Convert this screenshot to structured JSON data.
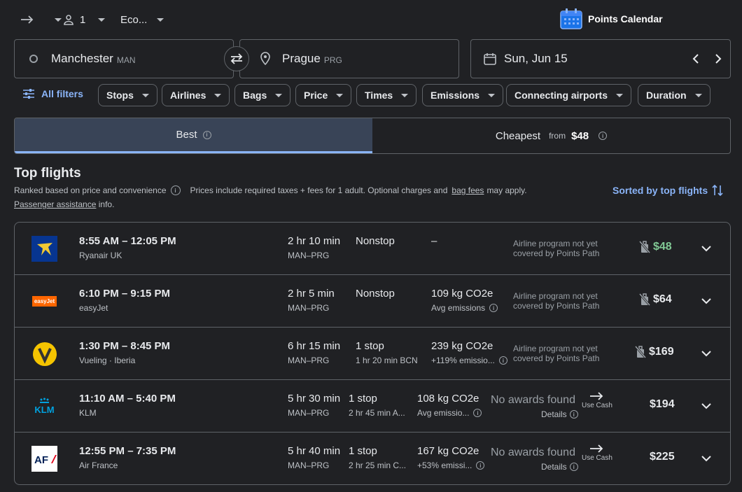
{
  "topbar": {
    "trip_type_icon": "arrow-right-icon",
    "passengers": "1",
    "cabin": "Eco...",
    "points_calendar": "Points Calendar"
  },
  "search": {
    "origin_city": "Manchester",
    "origin_code": "MAN",
    "dest_city": "Prague",
    "dest_code": "PRG",
    "date": "Sun, Jun 15"
  },
  "filters": {
    "all_filters": "All filters",
    "chips": [
      "Stops",
      "Airlines",
      "Bags",
      "Price",
      "Times",
      "Emissions",
      "Connecting airports",
      "Duration"
    ]
  },
  "tabs": {
    "best": "Best",
    "cheapest": "Cheapest",
    "from": "from",
    "from_price": "$48"
  },
  "section": {
    "title": "Top flights",
    "ranked": "Ranked based on price and convenience",
    "prices_note": "Prices include required taxes + fees for 1 adult. Optional charges and",
    "bag_fees": "bag fees",
    "may_apply": "may apply.",
    "passenger_assistance": "Passenger assistance",
    "info": "info.",
    "sorted": "Sorted by top flights"
  },
  "flights": [
    {
      "times": "8:55 AM – 12:05 PM",
      "airline": "Ryanair UK",
      "duration": "2 hr 10 min",
      "route": "MAN–PRG",
      "stops": "Nonstop",
      "stop_detail": "",
      "co2": "–",
      "emissions": "",
      "program": "Airline program not yet covered by Points Path",
      "price": "$48",
      "price_color": "#81c995"
    },
    {
      "times": "6:10 PM – 9:15 PM",
      "airline": "easyJet",
      "duration": "2 hr 5 min",
      "route": "MAN–PRG",
      "stops": "Nonstop",
      "stop_detail": "",
      "co2": "109 kg CO2e",
      "emissions": "Avg emissions",
      "program": "Airline program not yet covered by Points Path",
      "price": "$64",
      "price_color": "#e8eaed"
    },
    {
      "times": "1:30 PM – 8:45 PM",
      "airline": "Vueling · Iberia",
      "duration": "6 hr 15 min",
      "route": "MAN–PRG",
      "stops": "1 stop",
      "stop_detail": "1 hr 20 min BCN",
      "co2": "239 kg CO2e",
      "emissions": "+119% emissio...",
      "program": "Airline program not yet covered by Points Path",
      "price": "$169",
      "price_color": "#e8eaed"
    },
    {
      "times": "11:10 AM – 5:40 PM",
      "airline": "KLM",
      "duration": "5 hr 30 min",
      "route": "MAN–PRG",
      "stops": "1 stop",
      "stop_detail": "2 hr 45 min A...",
      "co2": "108 kg CO2e",
      "emissions": "Avg emissio...",
      "no_awards": "No awards found",
      "details": "Details",
      "use_cash": "Use Cash",
      "price": "$194",
      "price_color": "#e8eaed"
    },
    {
      "times": "12:55 PM – 7:35 PM",
      "airline": "Air France",
      "duration": "5 hr 40 min",
      "route": "MAN–PRG",
      "stops": "1 stop",
      "stop_detail": "2 hr 25 min C...",
      "co2": "167 kg CO2e",
      "emissions": "+53% emissi...",
      "no_awards": "No awards found",
      "details": "Details",
      "use_cash": "Use Cash",
      "price": "$225",
      "price_color": "#e8eaed"
    }
  ]
}
